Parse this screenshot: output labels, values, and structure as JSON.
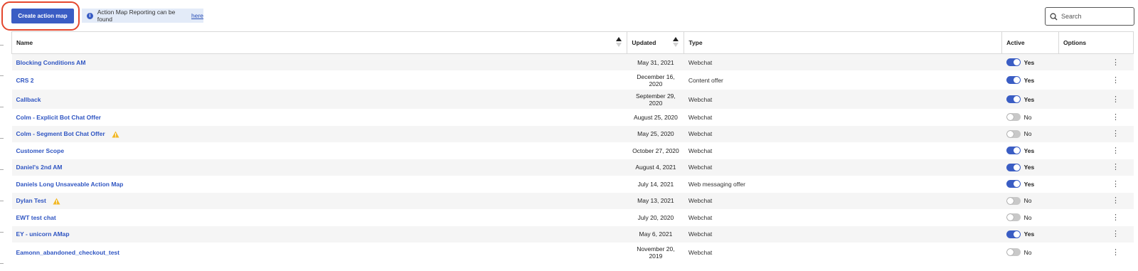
{
  "toolbar": {
    "create_label": "Create action map",
    "info_text": "Action Map Reporting can be found",
    "info_link": "here",
    "search_placeholder": "Search"
  },
  "columns": {
    "name": "Name",
    "updated": "Updated",
    "type": "Type",
    "active": "Active",
    "options": "Options"
  },
  "rows": [
    {
      "name": "Blocking Conditions AM",
      "updated": [
        "May 31, 2021"
      ],
      "type": "Webchat",
      "active": true,
      "active_label": "Yes",
      "warning": false
    },
    {
      "name": "CRS 2",
      "updated": [
        "December 16,",
        "2020"
      ],
      "type": "Content offer",
      "active": true,
      "active_label": "Yes",
      "warning": false
    },
    {
      "name": "Callback",
      "updated": [
        "September 29,",
        "2020"
      ],
      "type": "Webchat",
      "active": true,
      "active_label": "Yes",
      "warning": false
    },
    {
      "name": "Colm - Explicit Bot Chat Offer",
      "updated": [
        "August 25, 2020"
      ],
      "type": "Webchat",
      "active": false,
      "active_label": "No",
      "warning": false
    },
    {
      "name": "Colm - Segment Bot Chat Offer",
      "updated": [
        "May 25, 2020"
      ],
      "type": "Webchat",
      "active": false,
      "active_label": "No",
      "warning": true
    },
    {
      "name": "Customer Scope",
      "updated": [
        "October 27, 2020"
      ],
      "type": "Webchat",
      "active": true,
      "active_label": "Yes",
      "warning": false
    },
    {
      "name": "Daniel's 2nd AM",
      "updated": [
        "August 4, 2021"
      ],
      "type": "Webchat",
      "active": true,
      "active_label": "Yes",
      "warning": false
    },
    {
      "name": "Daniels Long Unsaveable Action Map",
      "updated": [
        "July 14, 2021"
      ],
      "type": "Web messaging offer",
      "active": true,
      "active_label": "Yes",
      "warning": false
    },
    {
      "name": "Dylan Test",
      "updated": [
        "May 13, 2021"
      ],
      "type": "Webchat",
      "active": false,
      "active_label": "No",
      "warning": true
    },
    {
      "name": "EWT test chat",
      "updated": [
        "July 20, 2020"
      ],
      "type": "Webchat",
      "active": false,
      "active_label": "No",
      "warning": false
    },
    {
      "name": "EY - unicorn AMap",
      "updated": [
        "May 6, 2021"
      ],
      "type": "Webchat",
      "active": true,
      "active_label": "Yes",
      "warning": false
    },
    {
      "name": "Eamonn_abandoned_checkout_test",
      "updated": [
        "November 20,",
        "2019"
      ],
      "type": "Webchat",
      "active": false,
      "active_label": "No",
      "warning": false
    }
  ],
  "colors": {
    "primary": "#3a5dc4",
    "link": "#2f55c2",
    "highlight_ring": "#e4472e",
    "warning": "#f2b825",
    "info_bg": "#e3ebf8"
  },
  "icons": {
    "info": "info-icon",
    "search": "search-icon",
    "warning": "warning-icon",
    "options": "kebab-menu-icon"
  }
}
